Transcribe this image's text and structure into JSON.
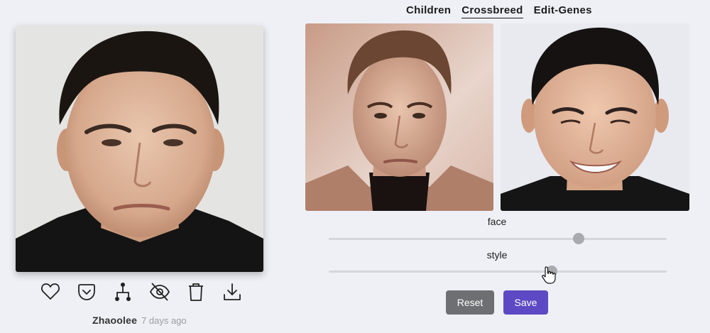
{
  "tabs": [
    {
      "label": "Children",
      "active": false
    },
    {
      "label": "Crossbreed",
      "active": true
    },
    {
      "label": "Edit-Genes",
      "active": false
    }
  ],
  "main_image": {
    "description": "child-portrait"
  },
  "actions": [
    {
      "icon": "heart-icon"
    },
    {
      "icon": "pocket-icon"
    },
    {
      "icon": "family-tree-icon"
    },
    {
      "icon": "eye-off-icon"
    },
    {
      "icon": "trash-icon"
    },
    {
      "icon": "download-icon"
    }
  ],
  "creator": {
    "name": "Zhaoolee",
    "time": "7 days ago"
  },
  "sliders": [
    {
      "label": "face",
      "value": 0.74
    },
    {
      "label": "style",
      "value": 0.66
    }
  ],
  "buttons": {
    "reset_label": "Reset",
    "save_label": "Save"
  },
  "colors": {
    "accent": "#5d49c3",
    "reset": "#6e6f72",
    "background": "#eef0f6"
  }
}
